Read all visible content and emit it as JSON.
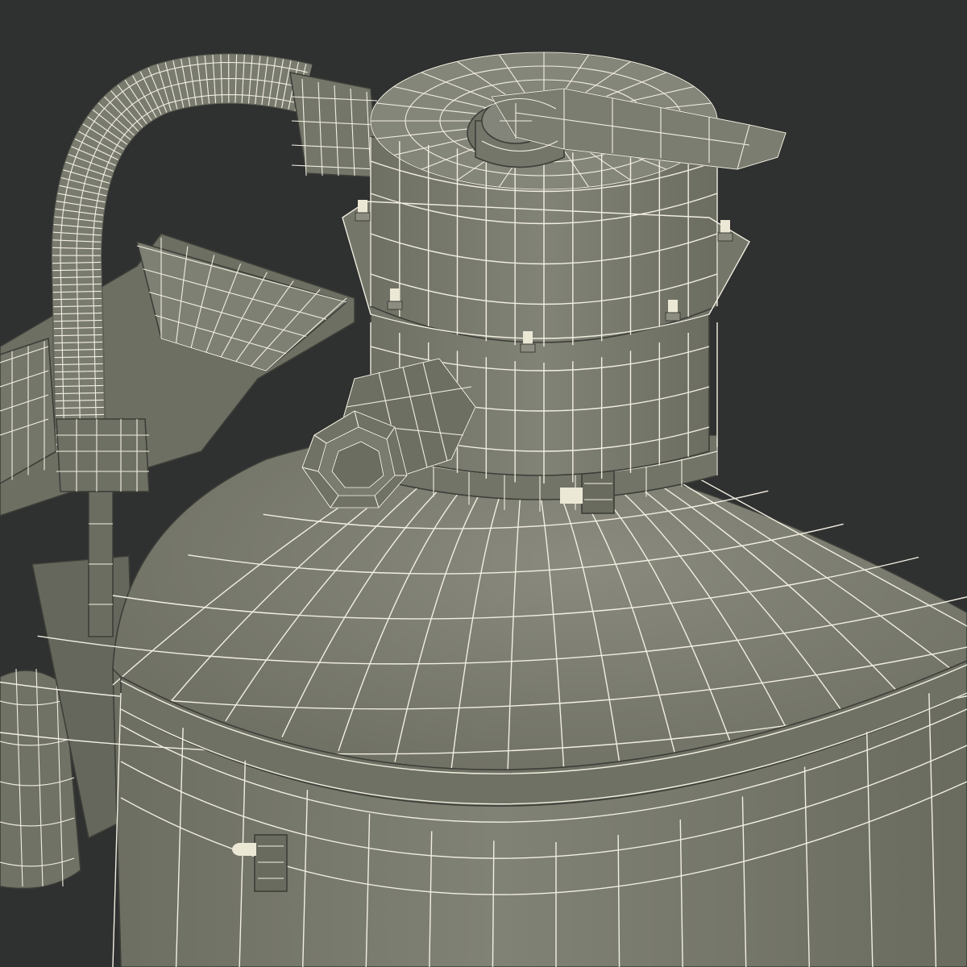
{
  "scene": {
    "background_color": "#2f3030",
    "surface_color": "#7b7c6f",
    "surface_shadow_color": "#5f6156",
    "surface_highlight_color": "#8c8d80",
    "wire_color": "#f2efe2",
    "bolt_color": "#ece8d6"
  },
  "objects": [
    {
      "name": "filter-tank",
      "label": ""
    },
    {
      "name": "multiport-valve",
      "label": ""
    },
    {
      "name": "valve-handle",
      "label": ""
    },
    {
      "name": "hose-pipe",
      "label": ""
    },
    {
      "name": "pump-housing",
      "label": ""
    },
    {
      "name": "side-port-fitting",
      "label": ""
    }
  ]
}
